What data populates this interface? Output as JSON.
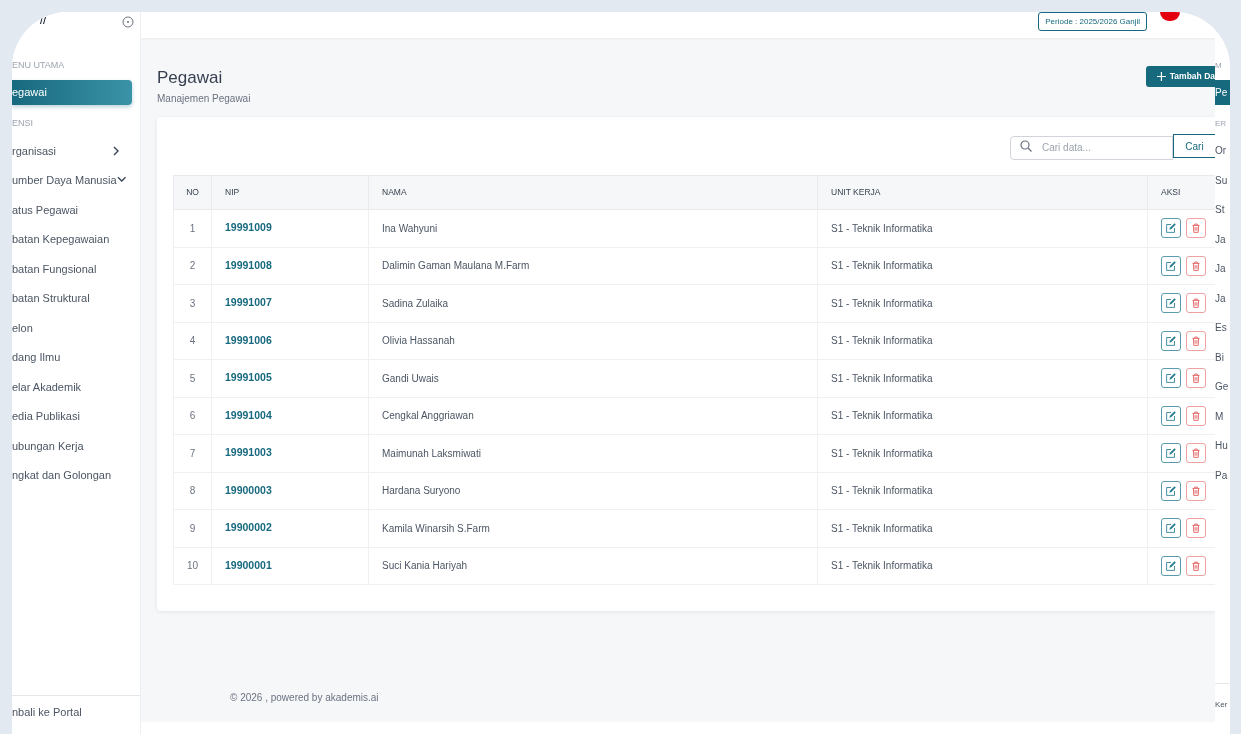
{
  "sidebar": {
    "sections": [
      {
        "heading": "ENU UTAMA",
        "items": [
          {
            "label": "egawai",
            "selected": true
          }
        ]
      },
      {
        "heading": "ENSI",
        "items": [
          {
            "label": "rganisasi",
            "selected": false,
            "expanded": false
          },
          {
            "label": "umber Daya Manusia",
            "selected": false,
            "expanded": true,
            "children": [
              {
                "label": "atus Pegawai",
                "selected": false
              },
              {
                "label": "batan Kepegawaian",
                "selected": false
              },
              {
                "label": "batan Fungsional",
                "selected": false
              },
              {
                "label": "batan Struktural",
                "selected": false
              },
              {
                "label": "elon",
                "selected": false
              },
              {
                "label": "dang Ilmu",
                "selected": false
              },
              {
                "label": "elar Akademik",
                "selected": false
              },
              {
                "label": "edia Publikasi",
                "selected": false
              },
              {
                "label": "ubungan Kerja",
                "selected": false
              },
              {
                "label": "ngkat dan Golongan",
                "selected": false
              }
            ]
          }
        ]
      }
    ],
    "footer_link": "nbali ke Portal"
  },
  "header": {
    "period_badge": "Periode : 2025/2026 Ganjil"
  },
  "page": {
    "title": "Pegawai",
    "subtitle": "Manajemen Pegawai",
    "add_button": "Tambah Da"
  },
  "search": {
    "placeholder": "Cari data...",
    "button": "Cari"
  },
  "table": {
    "columns": [
      "NO",
      "NIP",
      "NAMA",
      "UNIT KERJA",
      "AKSI"
    ],
    "rows": [
      {
        "no": "1",
        "nip": "19991009",
        "nama": "Ina Wahyuni",
        "unit": "S1 - Teknik Informatika"
      },
      {
        "no": "2",
        "nip": "19991008",
        "nama": "Dalimin Gaman Maulana M.Farm",
        "unit": "S1 - Teknik Informatika"
      },
      {
        "no": "3",
        "nip": "19991007",
        "nama": "Sadina Zulaika",
        "unit": "S1 - Teknik Informatika"
      },
      {
        "no": "4",
        "nip": "19991006",
        "nama": "Olivia Hassanah",
        "unit": "S1 - Teknik Informatika"
      },
      {
        "no": "5",
        "nip": "19991005",
        "nama": "Gandi Uwais",
        "unit": "S1 - Teknik Informatika"
      },
      {
        "no": "6",
        "nip": "19991004",
        "nama": "Cengkal Anggriawan",
        "unit": "S1 - Teknik Informatika"
      },
      {
        "no": "7",
        "nip": "19991003",
        "nama": "Maimunah Laksmiwati",
        "unit": "S1 - Teknik Informatika"
      },
      {
        "no": "8",
        "nip": "19900003",
        "nama": "Hardana Suryono",
        "unit": "S1 - Teknik Informatika"
      },
      {
        "no": "9",
        "nip": "19900002",
        "nama": "Kamila Winarsih S.Farm",
        "unit": "S1 - Teknik Informatika"
      },
      {
        "no": "10",
        "nip": "19900001",
        "nama": "Suci Kania Hariyah",
        "unit": "S1 - Teknik Informatika"
      }
    ]
  },
  "footer": "© 2026 , powered by akademis.ai",
  "ghost_sidebar": {
    "fragments": [
      {
        "kind": "heading",
        "text": "M"
      },
      {
        "kind": "item",
        "text": "Pe",
        "selected": true
      },
      {
        "kind": "heading",
        "text": "ER"
      },
      {
        "kind": "item",
        "text": "Or",
        "selected": false
      },
      {
        "kind": "item",
        "text": "Su",
        "selected": false
      },
      {
        "kind": "item",
        "text": "St",
        "selected": false
      },
      {
        "kind": "item",
        "text": "Ja",
        "selected": false
      },
      {
        "kind": "item",
        "text": "Ja",
        "selected": false
      },
      {
        "kind": "item",
        "text": "Ja",
        "selected": false
      },
      {
        "kind": "item",
        "text": "Es",
        "selected": false
      },
      {
        "kind": "item",
        "text": "Bi",
        "selected": false
      },
      {
        "kind": "item",
        "text": "Ge",
        "selected": false
      },
      {
        "kind": "item",
        "text": "M",
        "selected": false
      },
      {
        "kind": "item",
        "text": "Hu",
        "selected": false
      },
      {
        "kind": "item",
        "text": "Pa",
        "selected": false
      }
    ],
    "footer": "Ker"
  }
}
